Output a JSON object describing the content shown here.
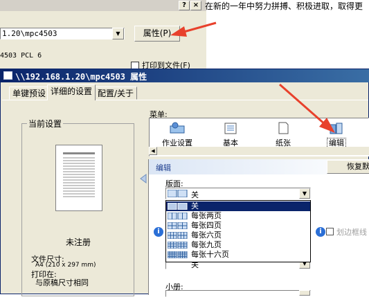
{
  "background_window": {
    "help_button": "?",
    "close_button": "×",
    "printer_name": "1.20\\mpc4503",
    "properties_button": "属性(P)",
    "driver": "4503 PCL 6",
    "print_to_file": "打印到文件(F)"
  },
  "editor_text": "在新的一年中努力拼搏、积极进取，取得更",
  "properties_dialog": {
    "title": "\\\\192.168.1.20\\mpc4503 属性",
    "tabs": [
      "单键预设",
      "详细的设置",
      "配置/关于"
    ],
    "current_settings": {
      "label": "当前设置",
      "status": "未注册",
      "file_size_label": "文件尺寸:",
      "file_size_value": "A4 (210 x 297 mm)",
      "print_on_label": "打印在:",
      "print_on_value": "与原稿尺寸相同"
    },
    "menu": {
      "label": "菜单:",
      "items": [
        {
          "label": "作业设置",
          "icon": "job-settings-icon"
        },
        {
          "label": "基本",
          "icon": "basic-icon"
        },
        {
          "label": "纸张",
          "icon": "paper-icon"
        },
        {
          "label": "编辑",
          "icon": "edit-icon"
        }
      ]
    },
    "section": {
      "title": "编辑",
      "restore_button": "恢复默认"
    },
    "layout": {
      "label": "版面:",
      "selected": "关",
      "options": [
        "关",
        "每张两页",
        "每张四页",
        "每张六页",
        "每张九页",
        "每张十六页"
      ]
    },
    "page_order": {
      "selected": "关"
    },
    "draw_border_label": "划边框线",
    "booklet_label": "小册:"
  },
  "colors": {
    "titlebar": "#0a246a",
    "dialog_bg": "#ece9d8",
    "selection": "#0a246a",
    "annotation_arrow": "#e8412c"
  }
}
